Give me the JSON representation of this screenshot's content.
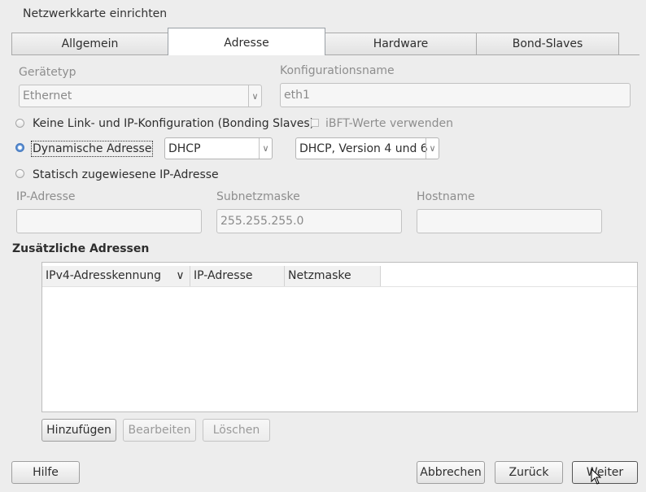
{
  "window": {
    "title": "Netzwerkkarte einrichten"
  },
  "tabs": [
    {
      "label": "Allgemein",
      "active": false
    },
    {
      "label": "Adresse",
      "active": true
    },
    {
      "label": "Hardware",
      "active": false
    },
    {
      "label": "Bond-Slaves",
      "active": false
    }
  ],
  "device": {
    "type_label": "Gerätetyp",
    "type_value": "Ethernet",
    "config_label": "Konfigurationsname",
    "config_value": "eth1"
  },
  "options": {
    "no_config_label": "Keine Link- und IP-Konfiguration (Bonding Slaves)",
    "ibft_label": "iBFT-Werte verwenden",
    "dynamic_label": "Dynamische Adresse",
    "dynamic_mode": "DHCP",
    "dynamic_version": "DHCP, Version 4 und 6",
    "static_label": "Statisch zugewiesene IP-Adresse"
  },
  "static_fields": {
    "ip_label": "IP-Adresse",
    "ip_value": "",
    "subnet_label": "Subnetzmaske",
    "subnet_value": "255.255.255.0",
    "host_label": "Hostname",
    "host_value": ""
  },
  "extra": {
    "heading": "Zusätzliche Adressen",
    "columns": [
      "IPv4-Adresskennung",
      "IP-Adresse",
      "Netzmaske"
    ],
    "rows": [],
    "add_label": "Hinzufügen",
    "edit_label": "Bearbeiten",
    "delete_label": "Löschen"
  },
  "footer": {
    "help_label": "Hilfe",
    "cancel_label": "Abbrechen",
    "back_label": "Zurück",
    "next_label": "Weiter"
  },
  "colors": {
    "accent": "#4a7cc0",
    "background": "#ededed"
  }
}
